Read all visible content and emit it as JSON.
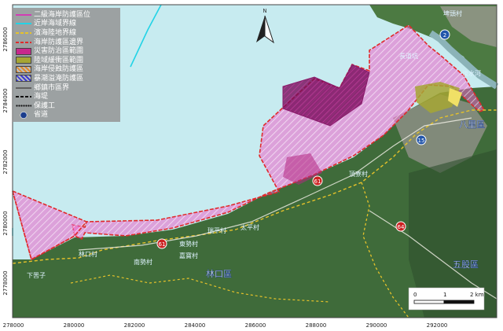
{
  "map": {
    "north_label": "N",
    "districts": [
      {
        "name": "八里區"
      },
      {
        "name": "林口區"
      },
      {
        "name": "五股區"
      }
    ],
    "places": [
      {
        "name": "下罟子"
      },
      {
        "name": "林口村"
      },
      {
        "name": "南勢村"
      },
      {
        "name": "東勢村"
      },
      {
        "name": "嘉寶村"
      },
      {
        "name": "瑞平村"
      },
      {
        "name": "太平村"
      },
      {
        "name": "頂寮村"
      },
      {
        "name": "埤頭村"
      },
      {
        "name": "淡水河"
      },
      {
        "name": "長道坑"
      }
    ],
    "roads": [
      {
        "label": "2",
        "color": "#2255aa"
      },
      {
        "label": "15",
        "color": "#2255aa"
      },
      {
        "label": "61",
        "color": "#cc2222"
      },
      {
        "label": "61",
        "color": "#cc2222"
      },
      {
        "label": "64",
        "color": "#cc2222"
      }
    ],
    "axes": {
      "x_ticks": [
        "278000",
        "280000",
        "282000",
        "284000",
        "286000",
        "288000",
        "290000",
        "292000"
      ],
      "y_ticks": [
        "2786000",
        "2784000",
        "2782000",
        "2780000",
        "2778000"
      ]
    },
    "scale_bar": {
      "labels": [
        "0",
        "1",
        "2 km"
      ]
    }
  },
  "legend": {
    "items": [
      {
        "label": "二級海岸防護區位",
        "symbol": "line",
        "color": "#d23cb4"
      },
      {
        "label": "近岸海域界線",
        "symbol": "line",
        "color": "#22d3e6"
      },
      {
        "label": "濱海陸地界線",
        "symbol": "dash",
        "color": "#e6c22a"
      },
      {
        "label": "海岸防護區邊界",
        "symbol": "dash",
        "color": "#e02a2a"
      },
      {
        "label": "災害防治區範圍",
        "symbol": "fill",
        "color": "#c8288c"
      },
      {
        "label": "陸域緩衝區範圍",
        "symbol": "fill",
        "color": "#a6a634"
      },
      {
        "label": "海岸侵蝕防護區",
        "symbol": "hatch",
        "color": "#e28a2a"
      },
      {
        "label": "暴潮溢淹防護區",
        "symbol": "hatch",
        "color": "#3c3cd2"
      },
      {
        "label": "鄉鎮市區界",
        "symbol": "line",
        "color": "#606060"
      },
      {
        "label": "海堤",
        "symbol": "dash",
        "color": "#111111"
      },
      {
        "label": "保護工",
        "symbol": "dots",
        "color": "#111111"
      },
      {
        "label": "省道",
        "symbol": "shield",
        "color": "#1a3c8c"
      }
    ]
  }
}
